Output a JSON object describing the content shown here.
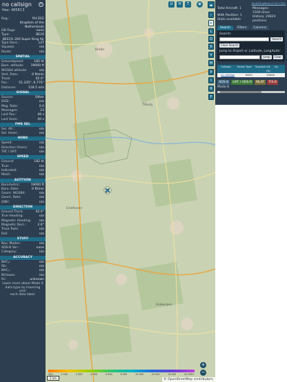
{
  "info": {
    "callsign": "no callsign",
    "hex_label": "Hex:",
    "hex": "485EC3",
    "rows": [
      {
        "k": "Reg.:",
        "v": "PH-ZCE"
      }
    ],
    "country": [
      "Kingdom of the",
      "Netherlands"
    ],
    "rows2": [
      {
        "k": "DB flags:",
        "v": "none"
      },
      {
        "k": "Type:",
        "v": "BE20"
      }
    ],
    "type_desc_line": "BEECH 200 Super King Air",
    "rows3": [
      {
        "k": "Type Desc.:",
        "v": "L2T"
      },
      {
        "k": "Squawk:",
        "v": "n/a"
      },
      {
        "k": "Route:",
        "v": "n/a"
      }
    ],
    "sections": [
      {
        "title": "SPATIAL",
        "rows": [
          {
            "k": "Groundspeed:",
            "v": "182 kt"
          },
          {
            "k": "Baro. altitude:",
            "v": "19000 ft"
          },
          {
            "k": "WGS84 altitude:",
            "v": "n/a"
          },
          {
            "k": "Vert. Rate:",
            "v": "0 ft/min"
          },
          {
            "k": "Track:",
            "v": "42.0°"
          },
          {
            "k": "Pos.:",
            "v": "51.335°, 6.775°"
          },
          {
            "k": "Distance:",
            "v": "118.5 nmi"
          }
        ]
      },
      {
        "title": "SIGNAL",
        "rows": [
          {
            "k": "Source:",
            "v": "Other"
          },
          {
            "k": "RSSI:",
            "v": "n/a"
          },
          {
            "k": "Msg. Rate:",
            "v": "0.0"
          },
          {
            "k": "Messages:",
            "v": "23"
          },
          {
            "k": "Last Pos.:",
            "v": "46 s"
          },
          {
            "k": "Last Seen:",
            "v": "40 s"
          }
        ]
      },
      {
        "title": "FMS SEL",
        "rows": [
          {
            "k": "Sel. Alt.:",
            "v": "n/a"
          },
          {
            "k": "Sel. Head.:",
            "v": "n/a"
          }
        ]
      },
      {
        "title": "WIND",
        "rows": [
          {
            "k": "Speed:",
            "v": "n/a"
          },
          {
            "k": "Direction (from):",
            "v": "n/a"
          },
          {
            "k": "TAT / OAT:",
            "v": "n/a"
          }
        ]
      },
      {
        "title": "SPEED",
        "rows": [
          {
            "k": "Ground:",
            "v": "182 kt"
          },
          {
            "k": "True:",
            "v": "n/a"
          },
          {
            "k": "Indicated:",
            "v": "n/a"
          },
          {
            "k": "Mach:",
            "v": "n/a"
          }
        ]
      },
      {
        "title": "ALTITUDE",
        "rows": [
          {
            "k": "Barometric:",
            "v": "19000 ft"
          },
          {
            "k": "Baro. Rate:",
            "v": "0 ft/min"
          },
          {
            "k": "Geom. WGS84:",
            "v": "n/a"
          },
          {
            "k": "Geom. Rate:",
            "v": "n/a"
          },
          {
            "k": "QNH:",
            "v": "n/a"
          }
        ]
      },
      {
        "title": "DIRECTION",
        "rows": [
          {
            "k": "Ground Track:",
            "v": "42.0°"
          },
          {
            "k": "True Heading:",
            "v": "n/a"
          },
          {
            "k": "Magnetic Heading:",
            "v": "n/a"
          },
          {
            "k": "Magnetic Decl.:",
            "v": "2.6°"
          },
          {
            "k": "Track Rate:",
            "v": "n/a"
          },
          {
            "k": "Roll:",
            "v": "n/a"
          }
        ]
      },
      {
        "title": "STUFF",
        "rows": [
          {
            "k": "Nav. Modes:",
            "v": "n/a"
          },
          {
            "k": "ADS-B Ver.:",
            "v": "none"
          },
          {
            "k": "Category:",
            "v": "n/a"
          }
        ]
      },
      {
        "title": "ACCURACY",
        "rows": [
          {
            "k": "NACₚ:",
            "v": "n/a"
          },
          {
            "k": "SIL:",
            "v": "n/a"
          },
          {
            "k": "NACᵥ:",
            "v": "n/a"
          },
          {
            "k": "NICʙᴀʀᴏ:",
            "v": "n/a"
          },
          {
            "k": "Rᴄ:",
            "v": "unknown"
          }
        ]
      }
    ],
    "note": [
      "Learn more about Mode S",
      "data type by hovering over",
      "each data label."
    ]
  },
  "map": {
    "top_buttons": [
      "U",
      "H",
      "T"
    ],
    "side_buttons": [
      "L",
      "O",
      "K",
      "V",
      "M",
      "P",
      "I",
      "R",
      "F"
    ],
    "zoom_in": "+",
    "zoom_out": "−",
    "scale": "2 km",
    "attribution": "© OpenStreetMap contributors.",
    "place_labels": [
      "Breda",
      "Tilburg",
      "Eindhoven",
      "Antwerpen"
    ],
    "alt_labels": [
      "500",
      "1 000",
      "2 000",
      "4 000",
      "6 000",
      "8 000",
      "10 000",
      "20 000",
      "30 000",
      "40 000+"
    ]
  },
  "side": {
    "version": "tar1090 github (3.14.1700)",
    "total_label": "Total Aircraft:",
    "total": "1",
    "with_pos_label": "With Position:",
    "with_pos": "1",
    "stats_label": "Stats available",
    "messages_label": "Messages:",
    "messages": "1500.0/sec",
    "history_label": "History:",
    "history": "29824 positions",
    "tabs": [
      "Search",
      "Filters",
      "Columns"
    ],
    "search_label": "Search:",
    "search_button": "Search",
    "clear_search": "Clear Search",
    "jump_label": "Jump to Airport or Latitude, Longitude:",
    "jump_button": "Jump",
    "clear_button": "Clear",
    "columns": [
      "",
      "Callsign",
      "Route",
      "Type",
      "Squawk",
      "Alt. (ft)",
      "Sp."
    ],
    "rows": [
      [
        "",
        "no callsign",
        "",
        "BE20",
        "",
        "19000",
        ""
      ]
    ],
    "legend": [
      {
        "label": "ADS-B",
        "bg": "#3a5f7a",
        "fg": "#ffffff"
      },
      {
        "label": "UAT / ADS-R",
        "bg": "#3f7a3a",
        "fg": "#ffffff"
      },
      {
        "label": "MLAT",
        "bg": "#7a6f3a",
        "fg": "#ffffff"
      },
      {
        "label": "TIS-B",
        "bg": "#9a3a3a",
        "fg": "#ffffff"
      }
    ],
    "modes_label": "Mode-S"
  },
  "colors": {
    "panel": "#2c3e50",
    "accent": "#1f6b87",
    "map_bg": "#c9d3b3"
  }
}
